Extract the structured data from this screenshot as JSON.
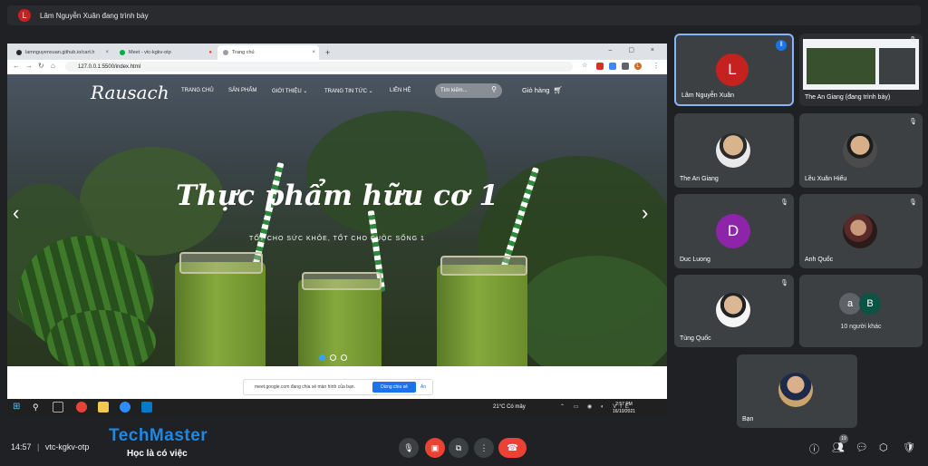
{
  "presenter": {
    "initial": "L",
    "text": "Lâm Nguyễn Xuân đang trình bày"
  },
  "browser": {
    "tabs": [
      {
        "label": "lamnguyenxuan.github.io/cart.h",
        "close": "×"
      },
      {
        "label": "Meet - vtc-kgkv-otp",
        "close": "×"
      },
      {
        "label": "Trang chủ",
        "close": "×"
      }
    ],
    "new_tab": "+",
    "window_controls": "– ▢ ×",
    "url": "127.0.0.1:5500/index.html",
    "avatar_initial": "L"
  },
  "site": {
    "logo": "Rausach",
    "nav": [
      "TRANG CHỦ",
      "SẢN PHẨM",
      "GIỚI THIỆU ⌄",
      "TRANG TIN TỨC ⌄",
      "LIÊN HỆ"
    ],
    "search_placeholder": "Tìm kiếm...",
    "cart_label": "Giỏ hàng",
    "hero_title": "Thực phẩm hữu cơ 1",
    "hero_subtitle": "TỐT CHO SỨC KHỎE, TỐT CHO CUỘC SỐNG 1",
    "prev": "‹",
    "next": "›",
    "slide_index": 1,
    "slide_count": 3
  },
  "share_bar": {
    "text": "meet.google.com đang chia sẻ màn hình của bạn.",
    "stop_label": "Dừng chia sẻ",
    "hide_label": "Ẩn"
  },
  "taskbar": {
    "weather": "21°C Có mây",
    "lang": "VIE",
    "time": "2:57 PM",
    "date": "16/10/2021"
  },
  "participants": [
    {
      "name": "Lâm Nguyễn Xuân",
      "initial": "L",
      "avatar_color": "#c5221f",
      "muted": false,
      "speaking": true
    },
    {
      "name": "The An Giang (đang trình bày)",
      "muted": true,
      "presenting": true
    },
    {
      "name": "The An Giang",
      "muted": false,
      "photo": true
    },
    {
      "name": "Lều Xuân Hiếu",
      "muted": true,
      "photo": true
    },
    {
      "name": "Duc Luong",
      "initial": "D",
      "avatar_color": "#8e24aa",
      "muted": true
    },
    {
      "name": "Anh Quốc",
      "muted": true,
      "photo": true
    },
    {
      "name": "Tùng Quốc",
      "muted": true,
      "photo": true
    },
    {
      "name": "10 người khác",
      "initials": [
        "a",
        "B"
      ],
      "colors": [
        "#5f6368",
        "#0b5345"
      ]
    },
    {
      "name": "Bạn",
      "photo": true
    }
  ],
  "meeting": {
    "time": "14:57",
    "code": "vtc-kgkv-otp"
  },
  "brand": {
    "name": "TechMaster",
    "tagline": "Học là có việc"
  },
  "participant_count": "19",
  "colors": {
    "accent": "#1a73e8",
    "end_call": "#ea4335",
    "surface": "#3c4043",
    "background": "#202124"
  }
}
